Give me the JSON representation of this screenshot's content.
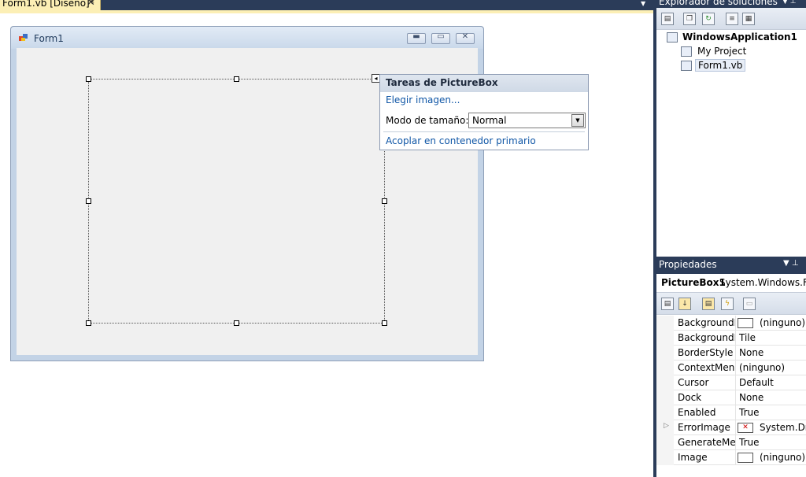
{
  "document_tab": {
    "label": "Form1.vb [Diseño]*",
    "close": "✕"
  },
  "form": {
    "title": "Form1",
    "minimize": "▬",
    "maximize": "▭",
    "close": "✕"
  },
  "picturebox_tasks": {
    "title": "Tareas de PictureBox",
    "choose_image": "Elegir imagen...",
    "size_mode_label": "Modo de tamaño:",
    "size_mode_value": "Normal",
    "dock_link": "Acoplar en contenedor primario"
  },
  "solution_explorer": {
    "title": "Explorador de soluciones",
    "project": "WindowsApplication1",
    "items": [
      "My Project",
      "Form1.vb"
    ]
  },
  "properties": {
    "title": "Propiedades",
    "object_name": "PictureBox1",
    "object_type": "System.Windows.Forms.PictureBox",
    "rows": [
      {
        "name": "BackgroundImage",
        "value": "(ninguno)"
      },
      {
        "name": "BackgroundImageLayout",
        "value": "Tile"
      },
      {
        "name": "BorderStyle",
        "value": "None"
      },
      {
        "name": "ContextMenuStrip",
        "value": "(ninguno)"
      },
      {
        "name": "Cursor",
        "value": "Default"
      },
      {
        "name": "Dock",
        "value": "None"
      },
      {
        "name": "Enabled",
        "value": "True"
      },
      {
        "name": "ErrorImage",
        "value": "System.Drawing.Bitmap"
      },
      {
        "name": "GenerateMember",
        "value": "True"
      },
      {
        "name": "Image",
        "value": "(ninguno)"
      }
    ]
  },
  "colors": {
    "chrome_dark": "#2b3c59",
    "tab_active": "#fcefb5",
    "link": "#0f56a6"
  }
}
